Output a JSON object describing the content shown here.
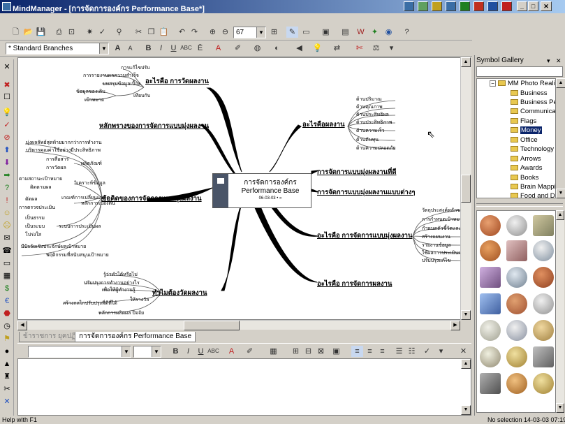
{
  "window": {
    "title": "MindManager - [การจัดการองค์กร Performance Base*]"
  },
  "toolbar": {
    "zoom": "67",
    "style": "* Standard Branches"
  },
  "map": {
    "central": {
      "line1": "การจัดการองค์กร",
      "line2": "Performance Base",
      "sub": "06-03-03 • »"
    },
    "topics": [
      "อะไรคือ การวัดผลงาน",
      "หลักพรางของการจัดการแบบมุ่งผลงาน",
      "ข้อคิดของการจัดการแบบมุ่งผลงาน",
      "ทำไมต้องวัดผลงาน",
      "อะไรคือผลงาน",
      "การจัดการแบบมุ่งผลงานที่ดี",
      "การจัดการแบบมุ่งผลงานแบบต่างๆ",
      "อะไรคือ การจัดการแบบมุ่งผลงาน",
      "อะไรคือ การจัดการผลงาน"
    ],
    "subs_a": [
      "การแก้ไขปรับ",
      "การรายงานผลความสำเร็จ",
      "บทสรุปข้อมูลเบื้อง",
      "เทียบกับ",
      "ข้อมูลของเดิม",
      "เป้าหมาย"
    ],
    "subs_b": [
      "มุ่งผลลัพธ์สุดท้ายมากกว่าการทำงาน",
      "บริหารคุณค่าใช้อย่างมีประสิทธิภาพ",
      "การสื่อสาร",
      "ผลิตภัณฑ์",
      "การวัดผล",
      "วิเคราะห์ข้อมูล",
      "หลักการเบื้องต้น",
      "ตามสถานะเป้าหมาย",
      "ติดตามผล",
      "เกณฑ์การเปลี่ยนแปลง",
      "ตัดผล",
      "การตรวจประเมิน",
      "ระบบการประเมินผล",
      "เป็นธรรม",
      "เป็นระบบ",
      "โปร่งใส",
      "มีปัจจัยเชิงประจักษ์ผลเป้าหมาย",
      "พฤติกรรมที่สนับสนุนเป้าหมาย"
    ],
    "subs_c": [
      "รู้ว่าทำได้หรือไม่",
      "ปรับปรุงการทำงานอย่างไร",
      "เพื่อให้ผู้ทำงานรู้",
      "ให้รางวัล",
      "สร้างกลไกปรับปรุงที่ดีที่ได้",
      "หลักการผลิตผล ปัจจัย"
    ],
    "subs_d": [
      "ด้านปริมาณ",
      "ด้านคุณภาพ",
      "ด้านประสิทธิผล",
      "ด้านประสิทธิภาพ",
      "ด้านความเร็ว",
      "ด้านต้นทุน",
      "ด้านความปลอดภัย"
    ],
    "subs_e": [
      "วัตถุประสงค์หลักขององค์กร",
      "การกำหนดเป้าหมาย",
      "กำหนดตัวชี้วัดและการวัดผล",
      "สร้างแผนงาน",
      "รายงานข้อมูล",
      "ใช้ผลการประเมินผล",
      "ปรับปรุงแก้ไข"
    ]
  },
  "tabs": [
    "ข้าราชการ ยุคปฏิรูป",
    "การจัดการองค์กร Performance Base"
  ],
  "side": {
    "header": "Symbol  Gallery",
    "tree_root": "MM Photo Realistic",
    "tree_items": [
      "Business",
      "Business People",
      "Communications",
      "Flags",
      "Money",
      "Office",
      "Technology",
      "Arrows",
      "Awards",
      "Books",
      "Brain Mapping",
      "Food and Drink"
    ],
    "selected_index": 4
  },
  "status": {
    "left": "Help with F1",
    "right": "No selection  14-03-03  07:19"
  },
  "colors": {
    "title_start": "#0a246a",
    "title_end": "#a6caf0",
    "branch": "#000000",
    "central_fill": "#ffffff",
    "central_side": "#4a5568",
    "selection": "#0a246a"
  }
}
